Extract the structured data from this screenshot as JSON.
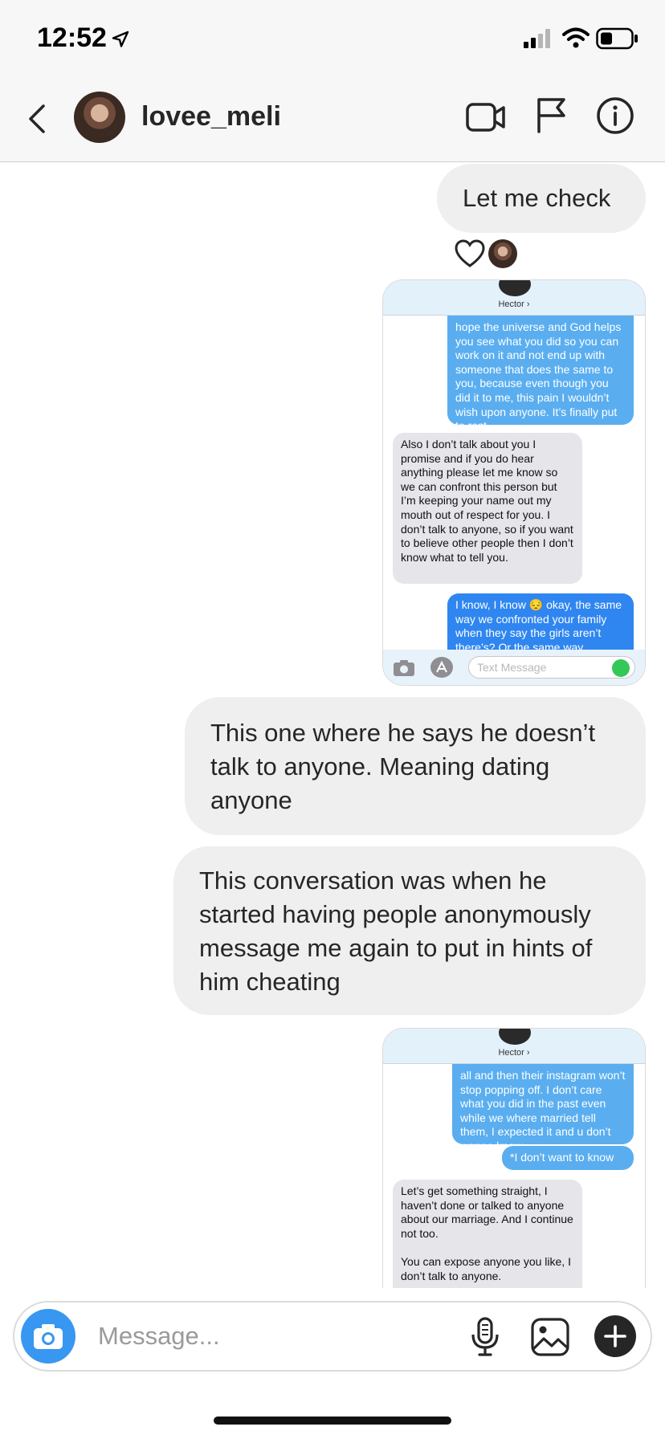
{
  "status_bar": {
    "time": "12:52"
  },
  "header": {
    "username": "lovee_meli"
  },
  "messages": [
    {
      "text": "Let me check"
    },
    {
      "text": "This one where he says he doesn’t talk to anyone. Meaning dating anyone"
    },
    {
      "text": "This conversation was when he started having people anonymously message me again to put in hints of him cheating"
    }
  ],
  "screenshot_1": {
    "contact_name": "Hector ›",
    "bubbles": [
      {
        "text": "hope the universe and God helps you see what you did so you can work on it and not end up with someone that does the same to you, because even though you did it to me, this pain I wouldn’t wish upon anyone. It’s finally put to rest."
      },
      {
        "text": "Also I don’t talk about you I promise and if you do hear anything please let me know so we can confront this person but I’m keeping your name out my mouth out of respect for you. I don’t talk to anyone, so if you want to believe other people then I don’t know what to tell you."
      },
      {
        "text": "I know, I know 😔 okay, the same way we confronted your family when they say the girls aren’t there’s? Or the same way"
      }
    ],
    "placeholder": "Text Message"
  },
  "screenshot_2": {
    "contact_name": "Hector ›",
    "bubbles": [
      {
        "text": "all and then their instagram won’t stop popping off. I don’t care what you did in the past even while we where married tell them, I expected it and u don’t wanna know."
      },
      {
        "text": "*I don’t want to know"
      },
      {
        "text": "Let’s get something straight, I haven’t done or talked to anyone about our marriage. And I continue not too.\n\nYou can expose anyone you like, I don’t talk to anyone."
      }
    ]
  },
  "composer": {
    "placeholder": "Message..."
  },
  "colors": {
    "accent": "#3897f0",
    "bubble_gray": "#efefef",
    "imessage_blue": "#5aaef0"
  }
}
